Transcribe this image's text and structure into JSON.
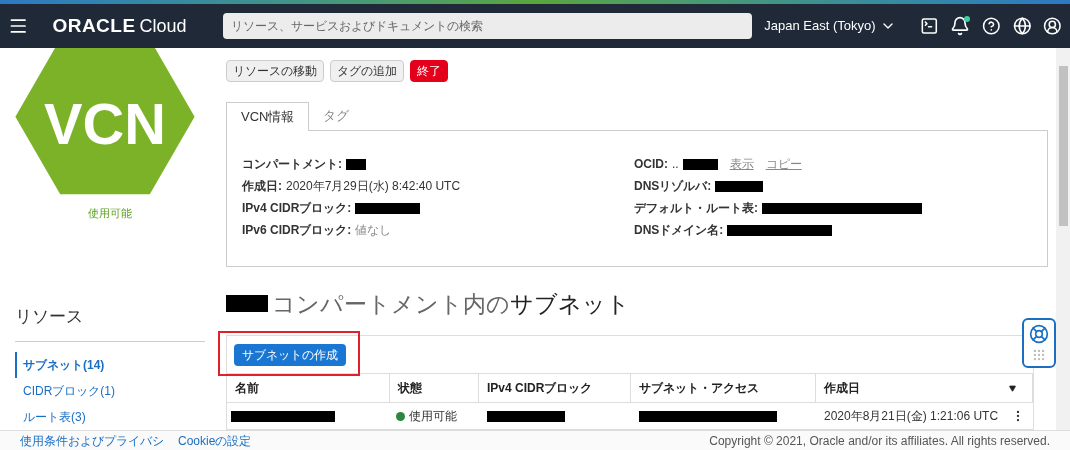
{
  "header": {
    "logo_brand": "ORACLE",
    "logo_product": "Cloud",
    "search": {
      "placeholder": "リソース、サービスおよびドキュメントの検索"
    },
    "region": "Japan East (Tokyo)",
    "notification_dot": true
  },
  "resource": {
    "badge": "VCN",
    "status": "使用可能"
  },
  "actions": [
    {
      "label": "リソースの移動",
      "kind": "default"
    },
    {
      "label": "タグの追加",
      "kind": "default"
    },
    {
      "label": "終了",
      "kind": "danger"
    }
  ],
  "tabs": [
    {
      "label": "VCN情報",
      "selected": true
    },
    {
      "label": "タグ",
      "selected": false
    }
  ],
  "info_left": [
    {
      "label": "コンパートメント:",
      "redacted": true
    },
    {
      "label": "作成日:",
      "value": "2020年7月29日(水) 8:42:40 UTC"
    },
    {
      "label": "IPv4 CIDRブロック:",
      "redacted": true
    },
    {
      "label": "IPv6 CIDRブロック:",
      "value": "値なし",
      "muted": true
    }
  ],
  "info_right": [
    {
      "label": "OCID:",
      "value": "..",
      "redacted": true,
      "links": [
        "表示",
        "コピー"
      ]
    },
    {
      "label": "DNSリゾルバ:",
      "redacted": true
    },
    {
      "label": "デフォルト・ルート表:",
      "redacted": true
    },
    {
      "label": "DNSドメイン名:",
      "redacted": true
    }
  ],
  "sidebar": {
    "title": "リソース",
    "items": [
      {
        "label": "サブネット(14)",
        "selected": true
      },
      {
        "label": "CIDRブロック(1)",
        "selected": false
      },
      {
        "label": "ルート表(3)",
        "selected": false
      }
    ]
  },
  "section": {
    "title": "コンパートメント内の",
    "title_emphasis": "サブネット",
    "create_button": "サブネットの作成",
    "highlighted": true
  },
  "table": {
    "columns": [
      "名前",
      "状態",
      "IPv4 CIDRブロック",
      "サブネット・アクセス",
      "作成日"
    ],
    "rows": [
      {
        "name_redacted": true,
        "status": "使用可能",
        "color": "#2e8540",
        "cidr_redacted": true,
        "access_redacted": true,
        "created": "2020年8月21日(金) 1:21:06 UTC"
      }
    ]
  },
  "footer": {
    "links": [
      "使用条件およびプライバシ",
      "Cookieの設定"
    ],
    "copyright": "Copyright © 2021, Oracle and/or its affiliates. All rights reserved."
  }
}
